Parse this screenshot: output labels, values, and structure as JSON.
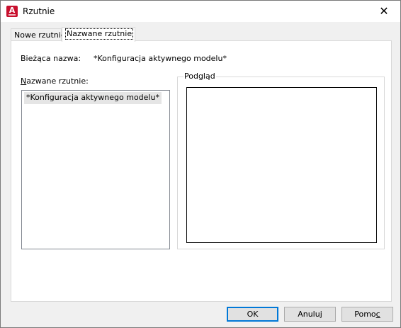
{
  "window": {
    "title": "Rzutnie",
    "app_icon": "autocad-icon",
    "close_glyph": "✕"
  },
  "tabs": [
    {
      "label": "Nowe rzutnie",
      "active": false
    },
    {
      "label": "Nazwane rzutnie",
      "active": true
    }
  ],
  "panel": {
    "current_label": "Bieżąca nazwa:",
    "current_value": "*Konfiguracja aktywnego modelu*",
    "named_label_prefix": "N",
    "named_label_rest": "azwane rzutnie:",
    "named_list": [
      {
        "label": "*Konfiguracja aktywnego modelu*",
        "selected": true
      }
    ],
    "preview_label": "Podgląd"
  },
  "buttons": {
    "ok": "OK",
    "cancel": "Anuluj",
    "help_prefix": "Pomo",
    "help_underlined": "c"
  },
  "colors": {
    "accent": "#0078d7",
    "app_icon_bg": "#c8102e"
  }
}
